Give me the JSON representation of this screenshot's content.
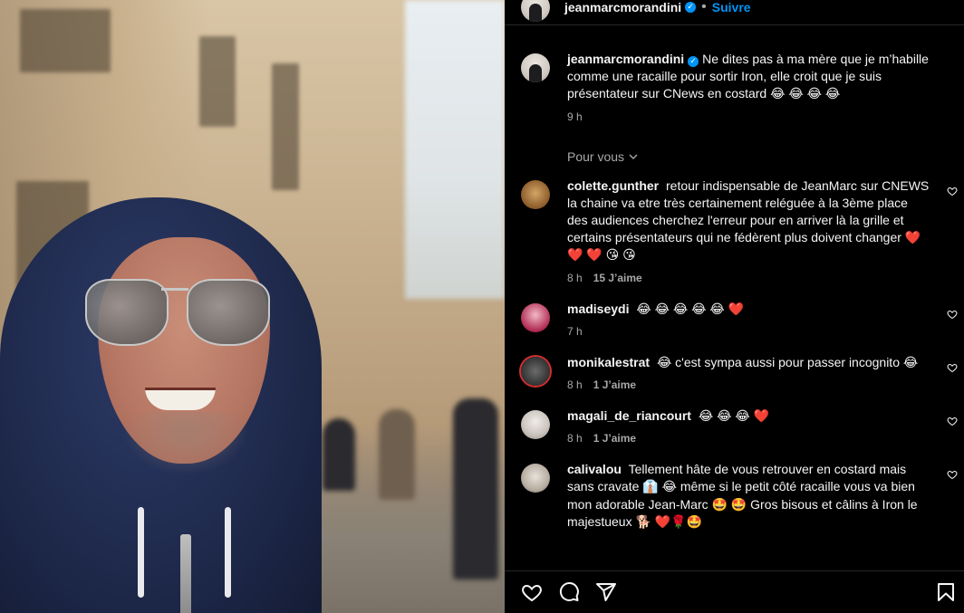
{
  "post": {
    "username": "jeanmarcmorandini",
    "follow_label": "Suivre",
    "separator": "•",
    "caption": "Ne dites pas à ma mère que je m’habille comme une racaille pour sortir Iron, elle croit que je suis présentateur sur CNews en costard 😂 😂 😂 😂",
    "time": "9 h"
  },
  "feed_filter": {
    "label": "Pour vous"
  },
  "comments": [
    {
      "username": "colette.gunther",
      "text": "retour indispensable de JeanMarc sur CNEWS la chaine va etre très certainement reléguée à la 3ème place des audiences cherchez l'erreur pour en arriver là la grille et certains présentateurs qui ne fédèrent plus doivent changer ❤️ ❤️ ❤️ 😘 😘",
      "time": "8 h",
      "likes": "15 J’aime"
    },
    {
      "username": "madiseydi",
      "text": "😂 😂 😂 😂 😂 ❤️",
      "time": "7 h",
      "likes": ""
    },
    {
      "username": "monikalestrat",
      "text": "😂 c'est sympa aussi pour passer incognito 😂",
      "time": "8 h",
      "likes": "1 J’aime"
    },
    {
      "username": "magali_de_riancourt",
      "text": "😂 😂 😂 ❤️",
      "time": "8 h",
      "likes": "1 J’aime"
    },
    {
      "username": "calivalou",
      "text": "Tellement hâte de vous retrouver en costard mais sans cravate 👔 😂 même si le petit côté racaille vous va bien mon adorable Jean-Marc 🤩 🤩 Gros bisous et câlins à Iron le majestueux 🐕 ❤️🌹🤩",
      "time": "",
      "likes": ""
    }
  ],
  "icons": {
    "like": "heart-icon",
    "comment": "comment-icon",
    "share": "share-icon",
    "save": "bookmark-icon",
    "verified": "verified-badge-icon",
    "dropdown": "chevron-down-icon"
  },
  "colors": {
    "background": "#000000",
    "text": "#f5f5f5",
    "secondary": "#a8a8a8",
    "accent": "#0095f6"
  }
}
